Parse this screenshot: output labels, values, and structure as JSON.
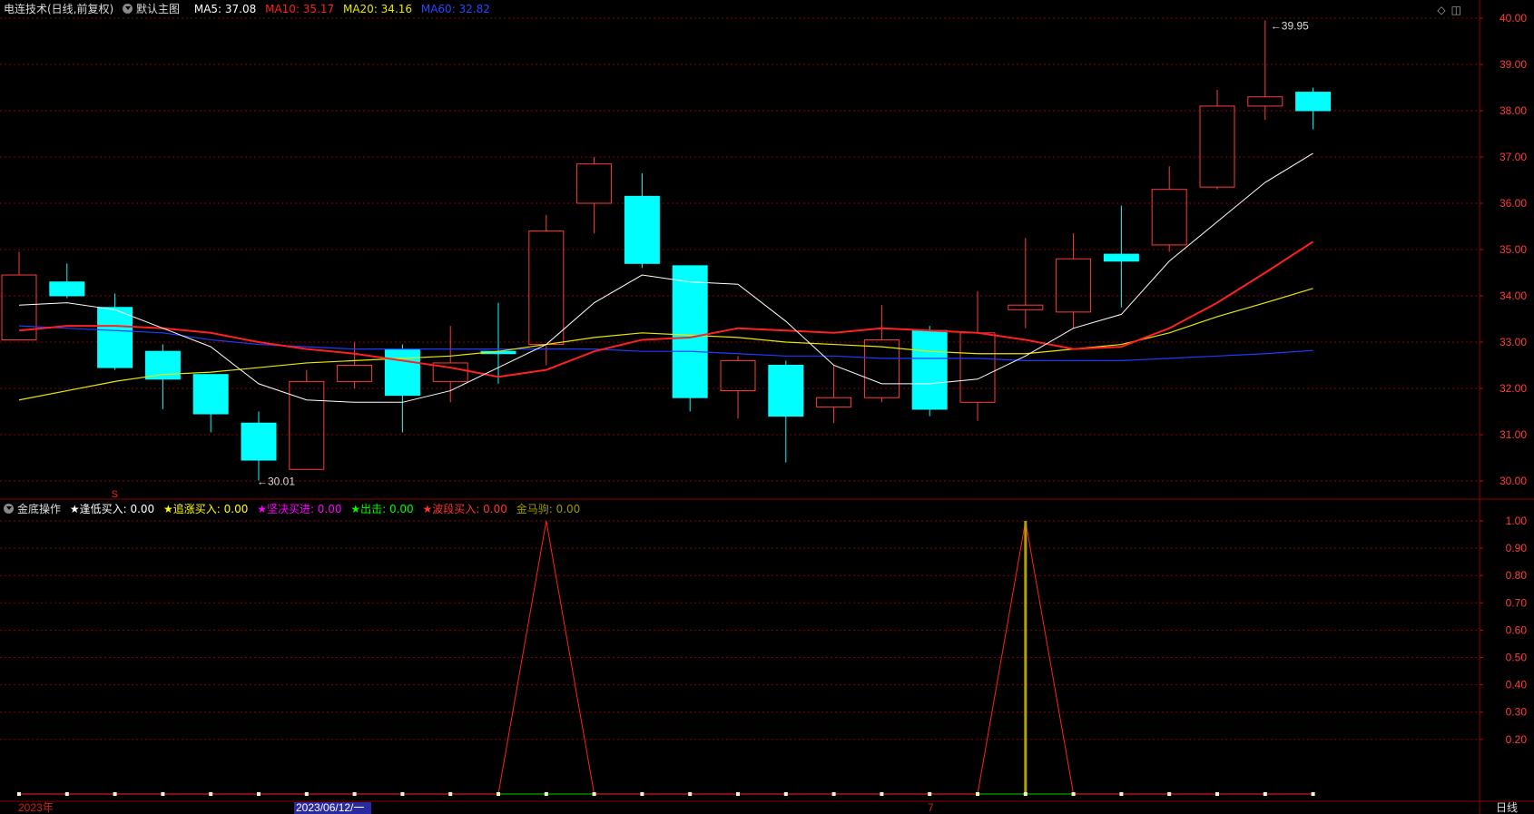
{
  "header": {
    "stock_title": "电连技术(日线,前复权)",
    "main_chart_label": "默认主图",
    "ma5": "MA5: 37.08",
    "ma10": "MA10: 35.17",
    "ma20": "MA20: 34.16",
    "ma60": "MA60: 32.82"
  },
  "indicator": {
    "name": "金底操作",
    "items": [
      {
        "label": "★逢低买入: 0.00",
        "color": "#ffffff"
      },
      {
        "label": "★追涨买入: 0.00",
        "color": "#ffff00"
      },
      {
        "label": "★坚决买进: 0.00",
        "color": "#ff00ff"
      },
      {
        "label": "★出击: 0.00",
        "color": "#00ff00"
      },
      {
        "label": "★波段买入: 0.00",
        "color": "#ff3333"
      },
      {
        "label": "金马驹: 0.00",
        "color": "#999900"
      }
    ]
  },
  "price_axis": {
    "ticks": [
      "40.00",
      "39.00",
      "38.00",
      "37.00",
      "36.00",
      "35.00",
      "34.00",
      "33.00",
      "32.00",
      "31.00",
      "30.00"
    ],
    "ylim": [
      29.75,
      40.2
    ]
  },
  "ind_axis": {
    "ticks": [
      "1.00",
      "0.90",
      "0.80",
      "0.70",
      "0.60",
      "0.50",
      "0.40",
      "0.30",
      "0.20"
    ],
    "ylim": [
      -0.03,
      1.03
    ]
  },
  "annotations": {
    "high": "39.95",
    "low": "30.01",
    "marker_s": "S"
  },
  "x_labels": {
    "year": "2023年",
    "cursor_date": "2023/06/12/一",
    "month": "7",
    "period": "日线"
  },
  "colors": {
    "up": "#ff3b3b",
    "down": "#00ffff",
    "ma5": "#ffffff",
    "ma10": "#ff2020",
    "ma20": "#e8e800",
    "ma60": "#1e3cff",
    "grid": "#8a0000"
  },
  "chart_data": {
    "type": "candlestick",
    "candles": [
      {
        "o": 33.05,
        "h": 34.95,
        "l": 33.05,
        "c": 34.45
      },
      {
        "o": 34.3,
        "h": 34.7,
        "l": 33.95,
        "c": 34.0
      },
      {
        "o": 33.75,
        "h": 34.05,
        "l": 32.4,
        "c": 32.45
      },
      {
        "o": 32.8,
        "h": 32.95,
        "l": 31.55,
        "c": 32.2
      },
      {
        "o": 32.3,
        "h": 32.3,
        "l": 31.05,
        "c": 31.45
      },
      {
        "o": 31.25,
        "h": 31.5,
        "l": 30.01,
        "c": 30.45
      },
      {
        "o": 30.25,
        "h": 32.4,
        "l": 30.25,
        "c": 32.15
      },
      {
        "o": 32.15,
        "h": 33.0,
        "l": 32.0,
        "c": 32.5
      },
      {
        "o": 32.85,
        "h": 32.95,
        "l": 31.05,
        "c": 31.85
      },
      {
        "o": 32.15,
        "h": 33.35,
        "l": 31.7,
        "c": 32.55
      },
      {
        "o": 32.8,
        "h": 33.85,
        "l": 32.1,
        "c": 32.75
      },
      {
        "o": 32.95,
        "h": 35.75,
        "l": 32.5,
        "c": 35.4
      },
      {
        "o": 36.0,
        "h": 37.0,
        "l": 35.35,
        "c": 36.85
      },
      {
        "o": 36.15,
        "h": 36.65,
        "l": 34.6,
        "c": 34.7
      },
      {
        "o": 34.65,
        "h": 34.65,
        "l": 31.5,
        "c": 31.8
      },
      {
        "o": 31.95,
        "h": 32.7,
        "l": 31.35,
        "c": 32.6
      },
      {
        "o": 32.5,
        "h": 32.6,
        "l": 30.4,
        "c": 31.4
      },
      {
        "o": 31.6,
        "h": 32.5,
        "l": 31.25,
        "c": 31.8
      },
      {
        "o": 31.8,
        "h": 33.8,
        "l": 31.7,
        "c": 33.05
      },
      {
        "o": 33.25,
        "h": 33.35,
        "l": 31.4,
        "c": 31.55
      },
      {
        "o": 31.7,
        "h": 34.1,
        "l": 31.3,
        "c": 33.2
      },
      {
        "o": 33.7,
        "h": 35.25,
        "l": 33.3,
        "c": 33.8
      },
      {
        "o": 33.65,
        "h": 35.35,
        "l": 33.3,
        "c": 34.8
      },
      {
        "o": 34.9,
        "h": 35.95,
        "l": 33.75,
        "c": 34.75
      },
      {
        "o": 35.1,
        "h": 36.8,
        "l": 34.95,
        "c": 36.3
      },
      {
        "o": 36.35,
        "h": 38.45,
        "l": 36.3,
        "c": 38.1
      },
      {
        "o": 38.1,
        "h": 39.95,
        "l": 37.8,
        "c": 38.3
      },
      {
        "o": 38.4,
        "h": 38.5,
        "l": 37.6,
        "c": 38.0
      }
    ],
    "ma5": [
      33.8,
      33.85,
      33.7,
      33.3,
      32.9,
      32.1,
      31.75,
      31.7,
      31.7,
      31.95,
      32.45,
      32.95,
      33.85,
      34.45,
      34.3,
      34.25,
      33.45,
      32.5,
      32.1,
      32.1,
      32.2,
      32.7,
      33.3,
      33.6,
      34.75,
      35.6,
      36.45,
      37.08
    ],
    "ma10": [
      33.25,
      33.35,
      33.35,
      33.3,
      33.2,
      33.0,
      32.85,
      32.75,
      32.6,
      32.45,
      32.25,
      32.4,
      32.8,
      33.05,
      33.1,
      33.3,
      33.25,
      33.2,
      33.3,
      33.25,
      33.2,
      33.05,
      32.85,
      32.9,
      33.3,
      33.85,
      34.5,
      35.17
    ],
    "ma20": [
      31.75,
      31.95,
      32.15,
      32.3,
      32.35,
      32.45,
      32.55,
      32.6,
      32.65,
      32.7,
      32.8,
      32.95,
      33.1,
      33.2,
      33.15,
      33.1,
      33.0,
      32.95,
      32.9,
      32.8,
      32.75,
      32.75,
      32.85,
      32.95,
      33.2,
      33.55,
      33.85,
      34.16
    ],
    "ma60": [
      33.35,
      33.3,
      33.25,
      33.2,
      33.05,
      32.95,
      32.9,
      32.85,
      32.85,
      32.85,
      32.85,
      32.85,
      32.85,
      32.8,
      32.8,
      32.75,
      32.7,
      32.7,
      32.65,
      32.65,
      32.65,
      32.6,
      32.6,
      32.6,
      32.65,
      32.7,
      32.75,
      32.82
    ],
    "signal_red": [
      0,
      0,
      0,
      0,
      0,
      0,
      0,
      0,
      0,
      0,
      0,
      1,
      0,
      0,
      0,
      0,
      0,
      0,
      0,
      0,
      0,
      1,
      0,
      0,
      0,
      0,
      0,
      0
    ],
    "signal_gold": [
      0,
      0,
      0,
      0,
      0,
      0,
      0,
      0,
      0,
      0,
      0,
      0,
      0,
      0,
      0,
      0,
      0,
      0,
      0,
      0,
      0,
      1,
      0,
      0,
      0,
      0,
      0,
      0
    ]
  }
}
